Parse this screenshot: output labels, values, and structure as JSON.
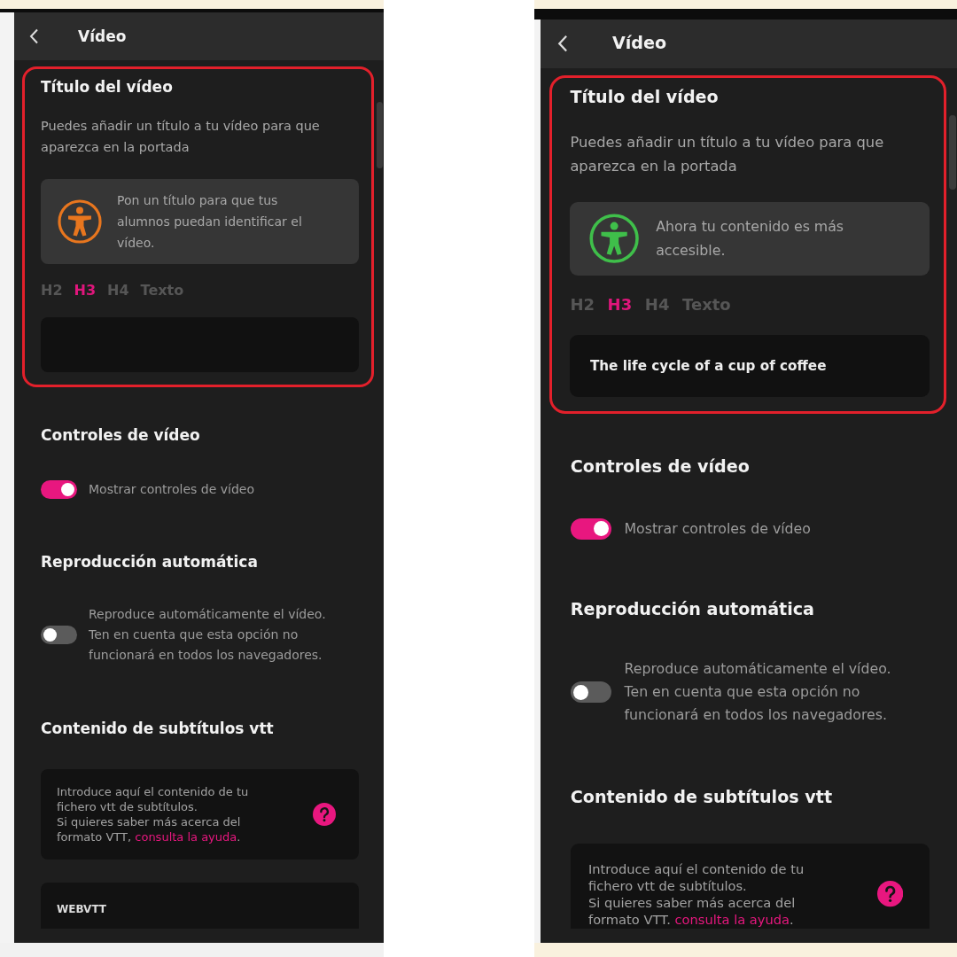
{
  "screens": [
    {
      "header": {
        "title": "Vídeo"
      },
      "title_section": {
        "highlighted": true,
        "heading": "Título del vídeo",
        "description": "Puedes añadir un título a tu vídeo para que aparezca en la portada",
        "notice": {
          "text": "Pon un título para que tus alumnos puedan identificar el vídeo.",
          "color": "#e8761e"
        },
        "heading_levels": [
          {
            "label": "H2",
            "selected": false
          },
          {
            "label": "H3",
            "selected": true
          },
          {
            "label": "H4",
            "selected": false
          },
          {
            "label": "Texto",
            "selected": false
          }
        ]
      },
      "video_controls": {
        "heading": "Controles de vídeo",
        "toggle": {
          "label": "Mostrar controles de vídeo",
          "on": true
        }
      },
      "autoplay": {
        "heading": "Reproducción automática",
        "toggle": {
          "label": "Reproduce automáticamente el vídeo. Ten en cuenta que esta opción no funcionará en todos los navegadores.",
          "on": false
        }
      },
      "subtitles": {
        "heading": "Contenido de subtítulos vtt",
        "help": {
          "paragraphs": [
            "Introduce aquí el contenido de tu fichero vtt de subtítulos.",
            "Si quieres saber más acerca del formato VTT, "
          ],
          "link": "consulta la ayuda",
          "link_after": "."
        },
        "vtt_field": {
          "value": "WEBVTT"
        }
      }
    },
    {
      "header": {
        "title": "Vídeo"
      },
      "title_section": {
        "highlighted": true,
        "heading": "Título del vídeo",
        "description": "Puedes añadir un título a tu vídeo para que aparezca en la portada",
        "notice": {
          "text": "Ahora tu contenido es más accesible.",
          "color": "#3fbf4a"
        },
        "heading_levels": [
          {
            "label": "H2",
            "selected": false
          },
          {
            "label": "H3",
            "selected": true
          },
          {
            "label": "H4",
            "selected": false
          },
          {
            "label": "Texto",
            "selected": false
          }
        ],
        "title_field": {
          "value": "The life cycle of a cup of coffee"
        }
      },
      "video_controls": {
        "heading": "Controles de vídeo",
        "toggle": {
          "label": "Mostrar controles de vídeo",
          "on": true
        }
      },
      "autoplay": {
        "heading": "Reproducción automática",
        "toggle": {
          "label": "Reproduce automáticamente el vídeo. Ten en cuenta que esta opción no funcionará en todos los navegadores.",
          "on": false
        }
      },
      "subtitles": {
        "heading": "Contenido de subtítulos vtt",
        "help": {
          "paragraphs": [
            "Introduce aquí el contenido de tu fichero vtt de subtítulos.",
            "Si quieres saber más acerca del formato VTT. "
          ],
          "link": "consulta la ayuda",
          "link_after": "."
        }
      }
    }
  ]
}
